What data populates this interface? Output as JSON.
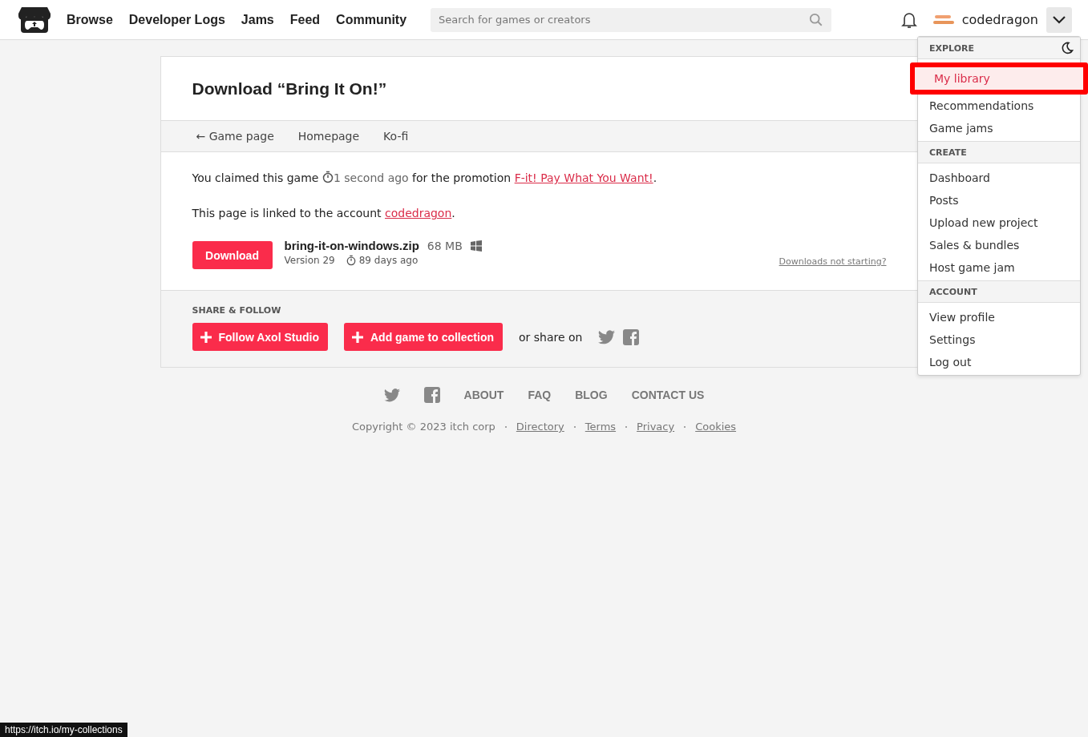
{
  "header": {
    "nav": [
      "Browse",
      "Developer Logs",
      "Jams",
      "Feed",
      "Community"
    ],
    "search": {
      "placeholder": "Search for games or creators"
    },
    "username": "codedragon"
  },
  "menu": {
    "sections": [
      {
        "title": "EXPLORE",
        "items": [
          {
            "label": "My library",
            "selected": true
          },
          {
            "label": "Recommendations",
            "selected": false
          },
          {
            "label": "Game jams",
            "selected": false
          }
        ]
      },
      {
        "title": "CREATE",
        "items": [
          {
            "label": "Dashboard",
            "selected": false
          },
          {
            "label": "Posts",
            "selected": false
          },
          {
            "label": "Upload new project",
            "selected": false
          },
          {
            "label": "Sales & bundles",
            "selected": false
          },
          {
            "label": "Host game jam",
            "selected": false
          }
        ]
      },
      {
        "title": "ACCOUNT",
        "items": [
          {
            "label": "View profile",
            "selected": false
          },
          {
            "label": "Settings",
            "selected": false
          },
          {
            "label": "Log out",
            "selected": false
          }
        ]
      }
    ]
  },
  "card": {
    "title": "Download “Bring It On!”",
    "tabs": [
      {
        "label": "← Game page"
      },
      {
        "label": "Homepage"
      },
      {
        "label": "Ko-fi"
      }
    ],
    "claim": {
      "before": "You claimed this game",
      "time": "1 second ago",
      "middle": "for the promotion",
      "link": "F-it! Pay What You Want!",
      "after": "."
    },
    "linked": {
      "before": "This page is linked to the account",
      "link": "codedragon",
      "after": "."
    },
    "download": {
      "button": "Download",
      "filename": "bring-it-on-windows.zip",
      "size": "68 MB",
      "version": "Version 29",
      "age": "89 days ago",
      "help": "Downloads not starting?"
    },
    "share": {
      "heading": "SHARE & FOLLOW",
      "buttons": [
        "Follow Axol Studio",
        "Add game to collection"
      ],
      "or": "or share on"
    }
  },
  "footer": {
    "links": [
      "ABOUT",
      "FAQ",
      "BLOG",
      "CONTACT US"
    ],
    "copyright": "Copyright © 2023 itch corp",
    "legal": [
      "Directory",
      "Terms",
      "Privacy",
      "Cookies"
    ]
  },
  "status_url": "https://itch.io/my-collections"
}
